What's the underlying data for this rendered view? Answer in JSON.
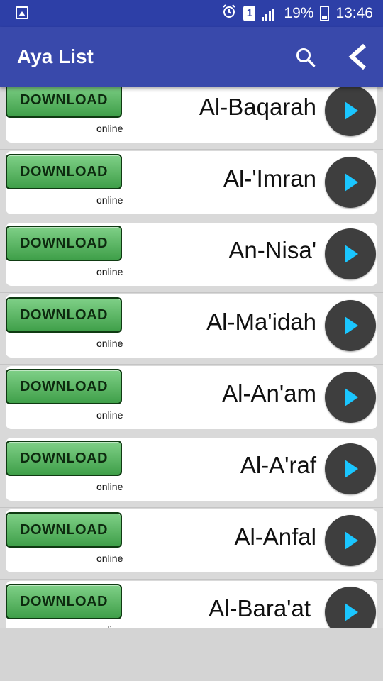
{
  "status_bar": {
    "battery": "19%",
    "time": "13:46",
    "sim_label": "1",
    "icons": [
      "image-notification-icon",
      "alarm-icon",
      "sim-icon",
      "signal-icon",
      "battery-charging-icon"
    ]
  },
  "app_bar": {
    "title": "Aya List",
    "icons": [
      "search-icon",
      "back-icon"
    ]
  },
  "list": {
    "items": [
      {
        "name": "Al-Baqarah",
        "download_label": "DOWNLOAD",
        "status": "online"
      },
      {
        "name": "Al-'Imran",
        "download_label": "DOWNLOAD",
        "status": "online"
      },
      {
        "name": "An-Nisa'",
        "download_label": "DOWNLOAD",
        "status": "online"
      },
      {
        "name": "Al-Ma'idah",
        "download_label": "DOWNLOAD",
        "status": "online"
      },
      {
        "name": "Al-An'am",
        "download_label": "DOWNLOAD",
        "status": "online"
      },
      {
        "name": "Al-A'raf",
        "download_label": "DOWNLOAD",
        "status": "online"
      },
      {
        "name": "Al-Anfal",
        "download_label": "DOWNLOAD",
        "status": "online"
      },
      {
        "name": "Al-Bara'at",
        "download_label": "DOWNLOAD",
        "status": "online"
      }
    ]
  },
  "colors": {
    "status_bar": "#2d3fa7",
    "app_bar": "#3949ab",
    "download_green": "#4caf50",
    "play_bg": "#3e3e3e",
    "play_arrow": "#1ac6ff"
  }
}
